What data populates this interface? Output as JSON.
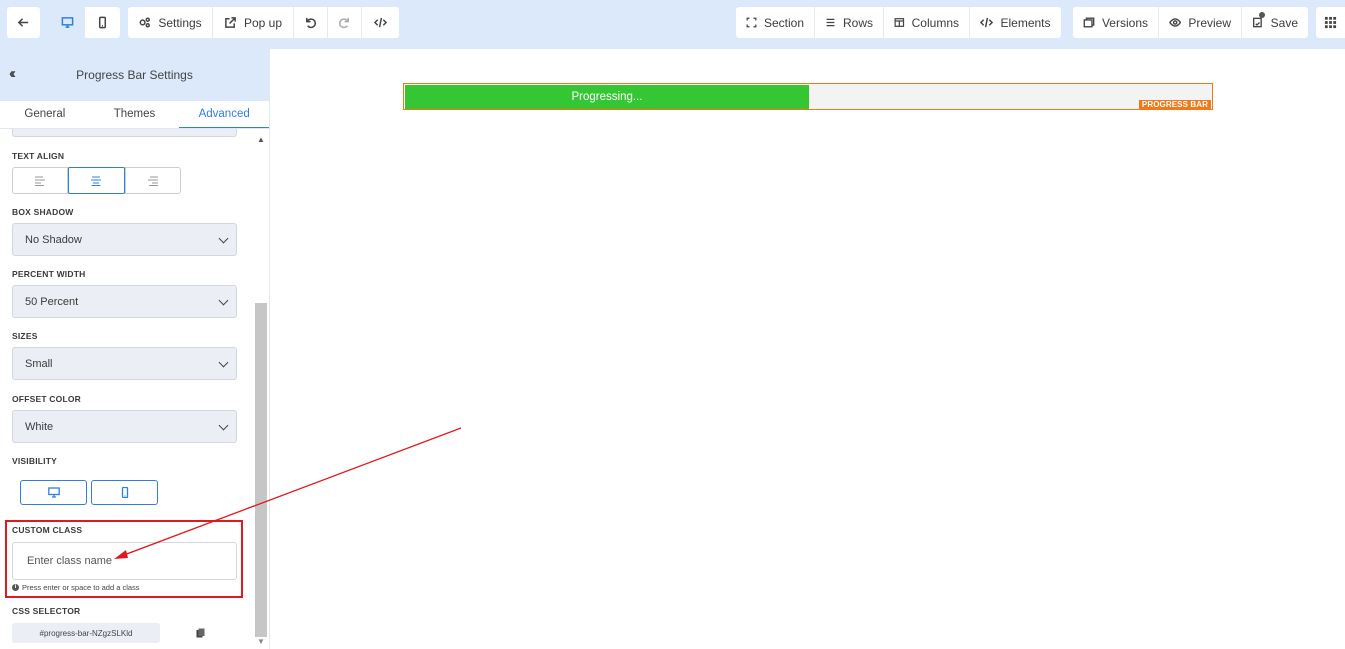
{
  "toolbar": {
    "settings_label": "Settings",
    "popup_label": "Pop up",
    "section_label": "Section",
    "rows_label": "Rows",
    "columns_label": "Columns",
    "elements_label": "Elements",
    "versions_label": "Versions",
    "preview_label": "Preview",
    "save_label": "Save"
  },
  "sidebar": {
    "title": "Progress Bar Settings",
    "tabs": [
      {
        "label": "General"
      },
      {
        "label": "Themes"
      },
      {
        "label": "Advanced"
      }
    ],
    "fields": {
      "text_align_label": "TEXT ALIGN",
      "box_shadow_label": "BOX SHADOW",
      "box_shadow_value": "No Shadow",
      "percent_width_label": "PERCENT WIDTH",
      "percent_width_value": "50 Percent",
      "sizes_label": "SIZES",
      "sizes_value": "Small",
      "offset_color_label": "OFFSET COLOR",
      "offset_color_value": "White",
      "visibility_label": "VISIBILITY",
      "custom_class_label": "CUSTOM CLASS",
      "custom_class_placeholder": "Enter class name",
      "custom_class_hint": "Press enter or space to add a class",
      "css_selector_label": "CSS SELECTOR",
      "css_selector_value": "#progress-bar-NZgzSLKld"
    }
  },
  "canvas": {
    "progress_text": "Progressing...",
    "progress_percent": 50,
    "element_tag": "PROGRESS BAR"
  },
  "colors": {
    "accent": "#2f7fe0",
    "toolbar_bg": "#dbe9fb",
    "progress_fill": "#35c733",
    "element_outline": "#f07a19",
    "annotation_red": "#e0191f"
  }
}
